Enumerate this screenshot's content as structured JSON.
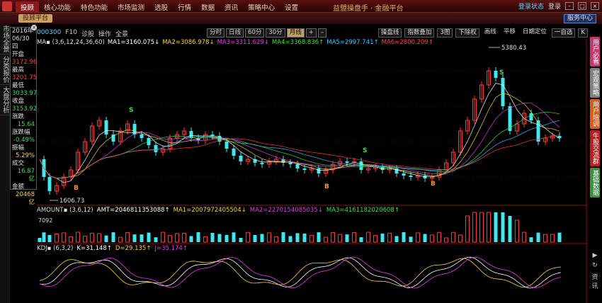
{
  "titlebar": {
    "menu": [
      "投顾",
      "核心功能",
      "特色功能",
      "市场监测",
      "选股",
      "行情",
      "数据",
      "资讯",
      "策略中心",
      "设置"
    ],
    "active_index": 0,
    "app_title": "益盟操盘手 · 金融平台",
    "login_status": "登录状态",
    "login": "登录",
    "min": "–",
    "max": "□",
    "close": "×"
  },
  "subbar": {
    "tab": "投顾平台",
    "service": "服务中心"
  },
  "leftstrip": [
    "市场全景",
    "分类报价",
    "大盘分析"
  ],
  "info": {
    "year": "2016年",
    "date": "06/30 四",
    "rows": [
      {
        "label": "开盘",
        "value": "3172.96",
        "cls": "red"
      },
      {
        "label": "最高",
        "value": "3201.75",
        "cls": "red"
      },
      {
        "label": "最低",
        "value": "3033.97",
        "cls": "green"
      },
      {
        "label": "收盘",
        "value": "3153.92",
        "cls": "green"
      },
      {
        "label": "涨跌",
        "value": "15.64",
        "cls": "green"
      },
      {
        "label": "涨跌幅",
        "value": "-0.49%",
        "cls": "green"
      },
      {
        "label": "振幅",
        "value": "5.29%",
        "cls": "yellow"
      },
      {
        "label": "成交",
        "value": "16.87亿",
        "cls": "green"
      },
      {
        "label": "金额",
        "value": "20468亿",
        "cls": "yellow"
      }
    ]
  },
  "toolbar": {
    "code": "000300",
    "items": [
      "F10",
      "诊股",
      "操作",
      "全景"
    ],
    "periods": [
      "分时",
      "日线",
      "60分",
      "30分",
      "月线",
      "+",
      "–"
    ],
    "selected_period": 4,
    "right": [
      "操盘线",
      "指数叠加",
      "3图",
      "下除权",
      "画线",
      "平移",
      "日期定位",
      "一自选",
      "K"
    ]
  },
  "ma_legend": [
    {
      "text": "MA▪ (3,6,12,24,36,60)",
      "color": "#dddddd"
    },
    {
      "text": "MA1=3160.075↓",
      "color": "#ffffff"
    },
    {
      "text": "MA2=3086.978↓",
      "color": "#ffd040"
    },
    {
      "text": "MA3=3311.629↓",
      "color": "#e040e0"
    },
    {
      "text": "MA4=3368.836↑",
      "color": "#40e040"
    },
    {
      "text": "MA5=2997.741↑",
      "color": "#40c0ff"
    },
    {
      "text": "MA6=2800.209↑",
      "color": "#ff4040"
    }
  ],
  "amt_legend": [
    {
      "text": "AMOUNT▪ (3,6,12)",
      "color": "#dddddd"
    },
    {
      "text": "AMT=2046811353088↑",
      "color": "#ffffff"
    },
    {
      "text": "MA1=2007972405504↓",
      "color": "#ffd040"
    },
    {
      "text": "MA2=2270154085035↓",
      "color": "#e040e0"
    },
    {
      "text": "MA3=4161182020608↑",
      "color": "#40e040"
    }
  ],
  "kdj_legend": [
    {
      "text": "KDJ▪ (6,3,2)",
      "color": "#dddddd"
    },
    {
      "text": "K=31.148↑",
      "color": "#ffffff"
    },
    {
      "text": "D=29.135↑",
      "color": "#ffd040"
    },
    {
      "text": "J=35.174↑",
      "color": "#e040e0"
    }
  ],
  "price_labels": {
    "high": "5380.43",
    "low": "1606.73"
  },
  "amt_axis": "7092",
  "rightbar": [
    {
      "label": "用户必看",
      "cls": "pink"
    },
    {
      "label": "宏观策略",
      "cls": "gray"
    },
    {
      "label": "用户培训",
      "cls": "orange"
    },
    {
      "label": "牛股交流群",
      "cls": "red"
    },
    {
      "label": "基础数据",
      "cls": "green"
    }
  ],
  "rightbottom": [
    "▶",
    "↻",
    "资讯"
  ],
  "chart_data": {
    "type": "candlestick",
    "title": "",
    "high_label": 5380.43,
    "low_label": 1606.73
  }
}
